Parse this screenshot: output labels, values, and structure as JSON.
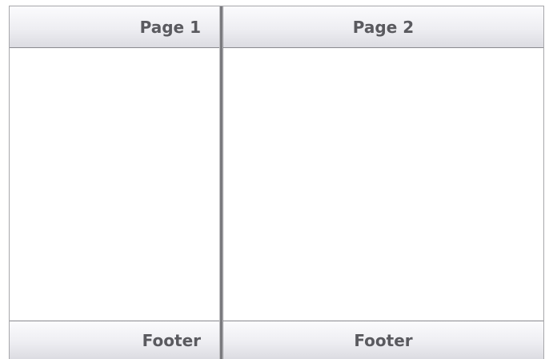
{
  "pages": [
    {
      "header_title": "Page 1",
      "footer_text": "Footer"
    },
    {
      "header_title": "Page 2",
      "footer_text": "Footer"
    }
  ],
  "colors": {
    "bar_text": "#5a5a5f",
    "divider": "#8a8a8f"
  }
}
